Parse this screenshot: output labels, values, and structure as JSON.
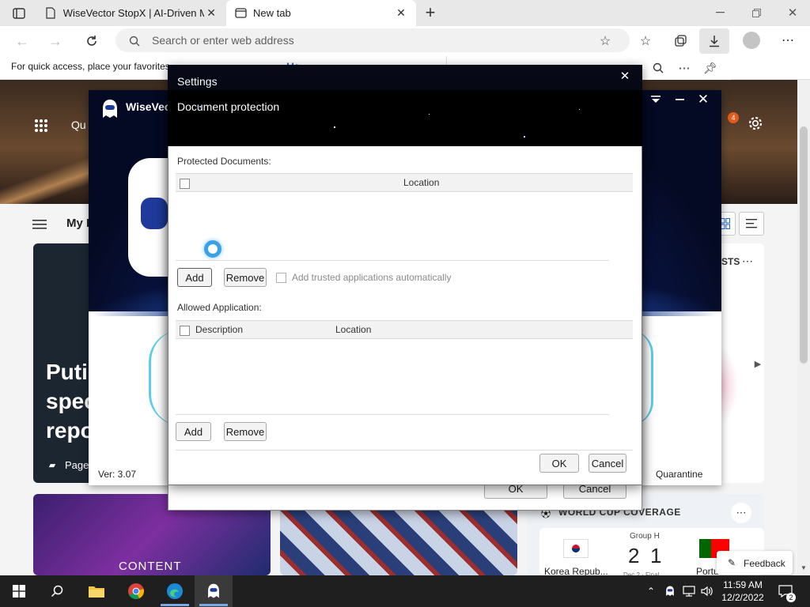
{
  "browser": {
    "tabs": [
      {
        "label": "WiseVector StopX | AI-Driven Ma",
        "active": false
      },
      {
        "label": "New tab",
        "active": true
      }
    ],
    "address_placeholder": "Search or enter web address",
    "favorites_hint": "For quick access, place your favorites",
    "favorites_hint_tail": "Ma",
    "new_tab_symbol": "+"
  },
  "ntp": {
    "quick_fragment": "Qu",
    "my_feed_fragment": "My F",
    "headline_lines": [
      "Putir",
      "spec",
      "repo"
    ],
    "page_label": "Page",
    "notification_count": "4",
    "rail_fragment": "STS",
    "world_cup": {
      "title": "WORLD CUP COVERAGE",
      "group": "Group H",
      "team1": "Korea Repub...",
      "team2": "Portu",
      "score1": "2",
      "score2": "1",
      "status": "Dec 2 · Final"
    },
    "movies_caption": "CONTENT",
    "feedback_label": "Feedback"
  },
  "wisevector": {
    "title": "WiseVector",
    "version": "Ver: 3.07",
    "quarantine": "Quarantine"
  },
  "settings": {
    "title": "Settings",
    "ok": "OK",
    "cancel": "Cancel"
  },
  "doc_protection": {
    "title": "Document protection",
    "protected_label": "Protected Documents:",
    "protected_columns": [
      "Location"
    ],
    "add": "Add",
    "remove": "Remove",
    "trusted_auto": "Add trusted applications automatically",
    "allowed_label": "Allowed Application:",
    "allowed_columns": [
      "Description",
      "Location"
    ],
    "ok": "OK",
    "cancel": "Cancel"
  },
  "taskbar": {
    "time": "11:59 AM",
    "date": "12/2/2022",
    "notif_count": "2"
  }
}
